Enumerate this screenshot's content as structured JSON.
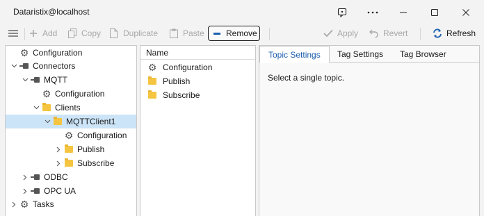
{
  "window": {
    "title": "Dataristix@localhost",
    "controls": [
      "feedback-icon",
      "more-icon",
      "minimize-icon",
      "maximize-icon",
      "close-icon"
    ]
  },
  "toolbar": {
    "add": "Add",
    "copy": "Copy",
    "duplicate": "Duplicate",
    "paste": "Paste",
    "remove": "Remove",
    "apply": "Apply",
    "revert": "Revert",
    "refresh": "Refresh"
  },
  "tree": {
    "items": [
      {
        "label": "Configuration",
        "icon": "gear-icon"
      },
      {
        "label": "Connectors",
        "icon": "plug-icon",
        "expanded": true
      },
      {
        "label": "MQTT",
        "icon": "plug-icon",
        "expanded": true
      },
      {
        "label": "Configuration",
        "icon": "gear-icon"
      },
      {
        "label": "Clients",
        "icon": "folder-icon",
        "expanded": true
      },
      {
        "label": "MQTTClient1",
        "icon": "folder-icon",
        "expanded": true,
        "selected": true
      },
      {
        "label": "Configuration",
        "icon": "gear-icon"
      },
      {
        "label": "Publish",
        "icon": "folder-icon",
        "expanded": false
      },
      {
        "label": "Subscribe",
        "icon": "folder-icon",
        "expanded": false
      },
      {
        "label": "ODBC",
        "icon": "plug-icon",
        "expanded": false
      },
      {
        "label": "OPC UA",
        "icon": "plug-icon",
        "expanded": false
      },
      {
        "label": "Tasks",
        "icon": "gears-icon",
        "expanded": false
      }
    ]
  },
  "list": {
    "header": "Name",
    "items": [
      {
        "label": "Configuration",
        "icon": "gear-icon"
      },
      {
        "label": "Publish",
        "icon": "folder-icon"
      },
      {
        "label": "Subscribe",
        "icon": "folder-icon"
      }
    ]
  },
  "detail": {
    "tabs": [
      "Topic Settings",
      "Tag Settings",
      "Tag Browser"
    ],
    "active_tab": "Topic Settings",
    "message": "Select a single topic."
  },
  "colors": {
    "accent": "#1c5fb0",
    "selection": "#cce4f7",
    "folder": "#f5c542"
  }
}
